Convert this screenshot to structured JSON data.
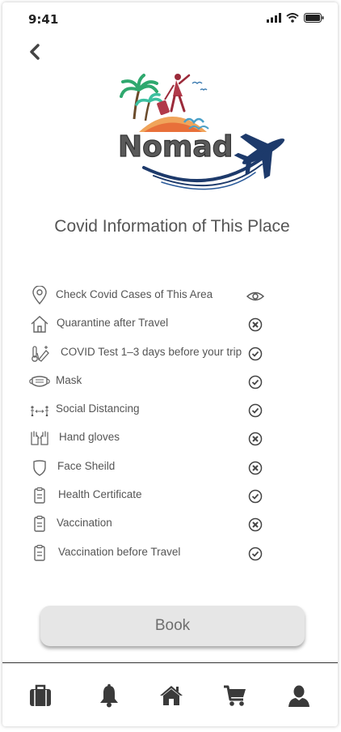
{
  "status_bar": {
    "time": "9:41",
    "icons": [
      "signal-icon",
      "wifi-icon",
      "battery-icon"
    ]
  },
  "header": {
    "back_icon": "chevron-left-icon"
  },
  "logo": {
    "text": "Nomad"
  },
  "page": {
    "title": "Covid Information of This Place"
  },
  "requirements": [
    {
      "label": "Check Covid Cases of This Area",
      "icon": "location-pin-icon",
      "status": "view"
    },
    {
      "label": "Quarantine after Travel",
      "icon": "house-icon",
      "status": "no"
    },
    {
      "label": "COVID Test 1–3 days before your trip",
      "icon": "thermometer-syringe-icon",
      "status": "yes"
    },
    {
      "label": "Mask",
      "icon": "mask-icon",
      "status": "yes"
    },
    {
      "label": "Social Distancing",
      "icon": "social-distancing-icon",
      "status": "yes"
    },
    {
      "label": "Hand gloves",
      "icon": "gloves-icon",
      "status": "no"
    },
    {
      "label": "Face Sheild",
      "icon": "shield-icon",
      "status": "no"
    },
    {
      "label": "Health Certificate",
      "icon": "clipboard-icon",
      "status": "yes"
    },
    {
      "label": "Vaccination",
      "icon": "clipboard-icon",
      "status": "no"
    },
    {
      "label": "Vaccination before Travel",
      "icon": "clipboard-icon",
      "status": "yes"
    }
  ],
  "actions": {
    "book_label": "Book"
  },
  "bottom_nav": [
    {
      "name": "trips",
      "icon": "briefcase-icon"
    },
    {
      "name": "notifications",
      "icon": "bell-icon"
    },
    {
      "name": "home",
      "icon": "home-icon"
    },
    {
      "name": "cart",
      "icon": "cart-icon"
    },
    {
      "name": "profile",
      "icon": "user-icon"
    }
  ],
  "colors": {
    "icon_gray": "#555555",
    "logo_navy": "#1d3a6b",
    "nav_icon": "#3a3a3a",
    "button_bg": "#e6e6e6"
  }
}
